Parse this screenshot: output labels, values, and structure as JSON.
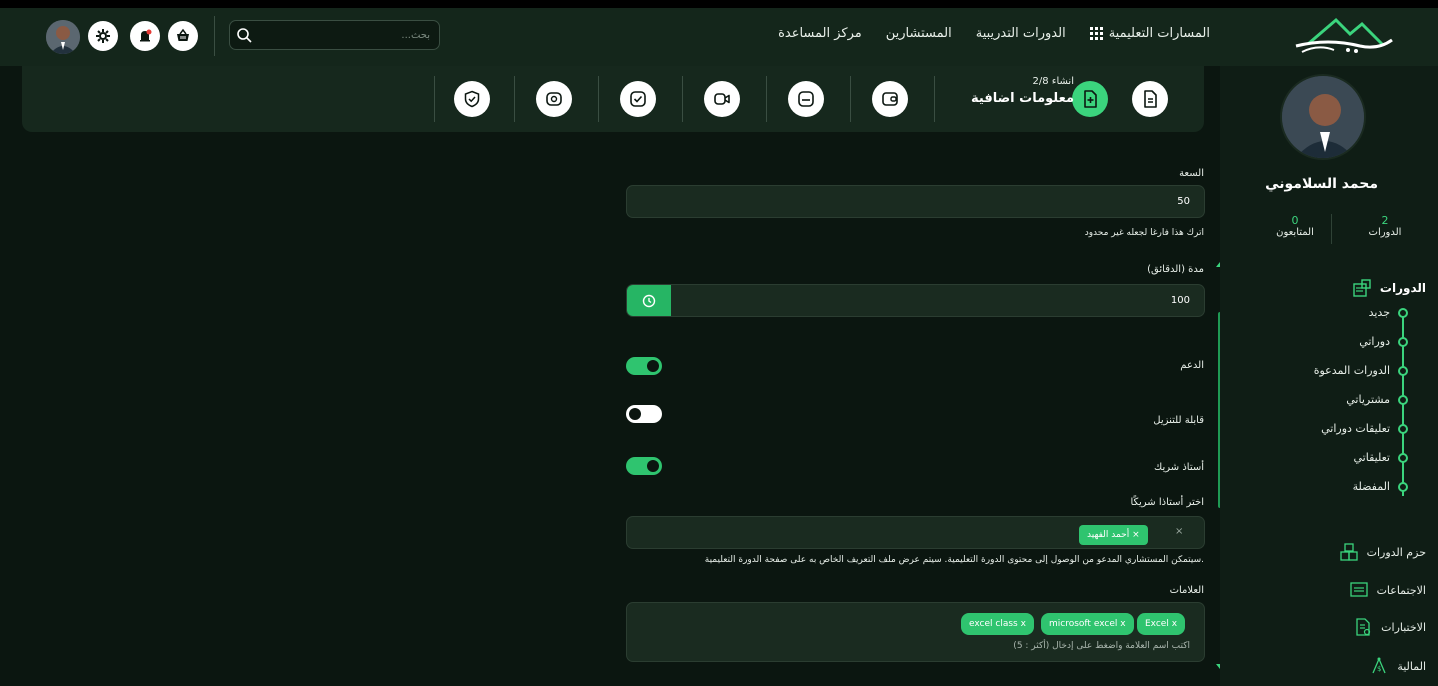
{
  "nav": {
    "links": [
      {
        "label": "المسارات التعليمية"
      },
      {
        "label": "الدورات التدريبية"
      },
      {
        "label": "المستشارين"
      },
      {
        "label": "مركز المساعدة"
      }
    ],
    "search_placeholder": "بحث..."
  },
  "sidebar": {
    "name": "محمد السلاموني",
    "stats": {
      "courses_count": "2",
      "courses_label": "الدورات",
      "followers_count": "0",
      "followers_label": "المتابعون"
    },
    "courses_heading": "الدورات",
    "course_items": [
      "جديد",
      "دوراتي",
      "الدورات المدعوة",
      "مشترياتي",
      "تعليقات دوراتي",
      "تعليقاتي",
      "المفضلة"
    ],
    "sections": [
      "حزم الدورات",
      "الاجتماعات",
      "الاختبارات",
      "المالية"
    ]
  },
  "stepper": {
    "count": "2/8",
    "count_prefix": "انشاء",
    "title": "معلومات اضافية"
  },
  "form": {
    "capacity_label": "السعة",
    "capacity_value": "50",
    "capacity_hint": "اترك هذا فارغا لجعله غير محدود",
    "duration_label": "مدة (الدقائق)",
    "duration_value": "100",
    "support_label": "الدعم",
    "support_on": true,
    "downloadable_label": "قابلة للتنزيل",
    "downloadable_on": false,
    "partner_label": "أستاذ شريك",
    "partner_on": true,
    "choose_partner_label": "اختر أستاذا شريكًا",
    "partner_chip": "أحمد الفهيد",
    "partner_hint": "سيتمكن المستشاري المدعو من الوصول إلى محتوى الدورة التعليمية. سيتم عرض ملف التعريف الخاص به على صفحة الدورة التعليمية.",
    "tags_label": "العلامات",
    "tags": [
      "Excel",
      "microsoft excel",
      "excel class"
    ],
    "tags_hint": "اكتب اسم العلامة واضغط على إدخال (أكثر : 5)"
  },
  "colors": {
    "accent": "#3bd47d",
    "background": "#0b1610",
    "topbar": "#14261b"
  }
}
